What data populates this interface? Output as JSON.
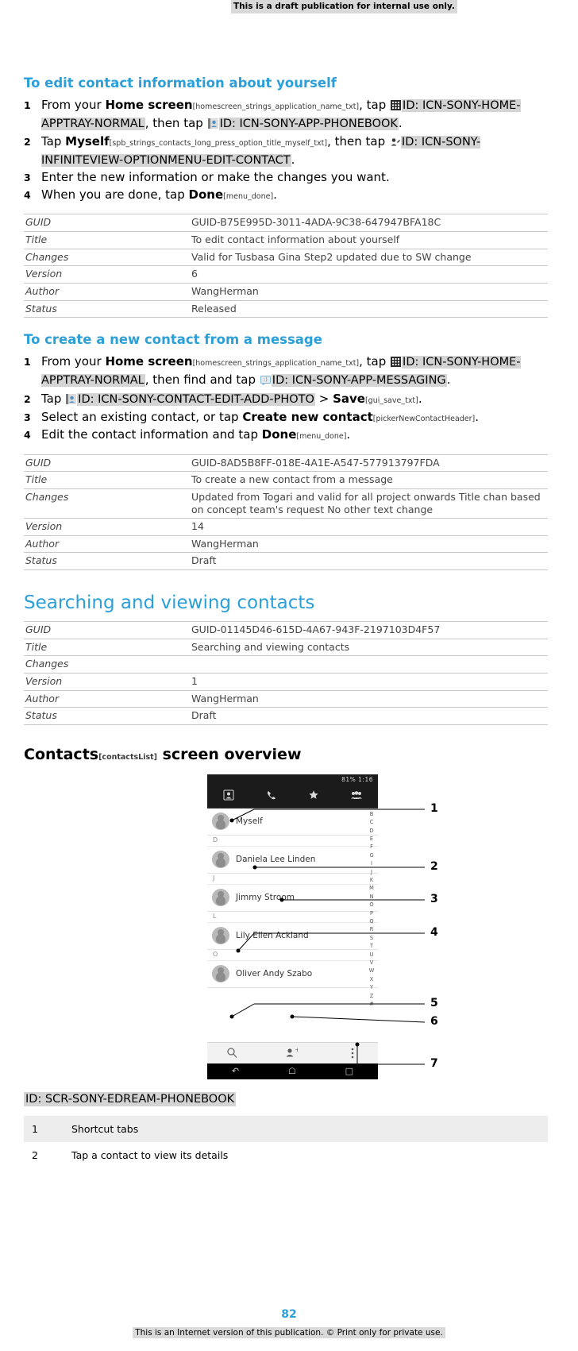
{
  "banner": "This is a draft publication for internal use only.",
  "sections": [
    {
      "title": "To edit contact information about yourself",
      "steps": [
        {
          "num": "1",
          "parts": [
            {
              "t": "text",
              "v": "From your "
            },
            {
              "t": "bold",
              "v": "Home screen"
            },
            {
              "t": "tag",
              "v": "[homescreen_strings_application_name_txt]"
            },
            {
              "t": "text",
              "v": ", tap "
            },
            {
              "t": "icon",
              "v": "apptray-grid-icon"
            },
            {
              "t": "id",
              "v": "ID: ICN-SONY-HOME-APPTRAY-NORMAL"
            },
            {
              "t": "text",
              "v": ", then tap "
            },
            {
              "t": "icon",
              "v": "phonebook-person-icon"
            },
            {
              "t": "id",
              "v": "ID: ICN-SONY-APP-PHONEBOOK"
            },
            {
              "t": "text",
              "v": "."
            }
          ]
        },
        {
          "num": "2",
          "parts": [
            {
              "t": "text",
              "v": "Tap "
            },
            {
              "t": "bold",
              "v": "Myself"
            },
            {
              "t": "tag",
              "v": "[spb_strings_contacts_long_press_option_title_myself_txt]"
            },
            {
              "t": "text",
              "v": ", then tap "
            },
            {
              "t": "icon",
              "v": "edit-contact-icon"
            },
            {
              "t": "id",
              "v": "ID: ICN-SONY-INFINITEVIEW-OPTIONMENU-EDIT-CONTACT"
            },
            {
              "t": "text",
              "v": "."
            }
          ]
        },
        {
          "num": "3",
          "parts": [
            {
              "t": "text",
              "v": "Enter the new information or make the changes you want."
            }
          ]
        },
        {
          "num": "4",
          "parts": [
            {
              "t": "text",
              "v": "When you are done, tap "
            },
            {
              "t": "bold",
              "v": "Done"
            },
            {
              "t": "tag",
              "v": "[menu_done]"
            },
            {
              "t": "text",
              "v": "."
            }
          ]
        }
      ],
      "meta": [
        {
          "key": "GUID",
          "value": "GUID-B75E995D-3011-4ADA-9C38-647947BFA18C"
        },
        {
          "key": "Title",
          "value": "To edit contact information about yourself"
        },
        {
          "key": "Changes",
          "value": "Valid for Tusbasa Gina Step2 updated due to SW change"
        },
        {
          "key": "Version",
          "value": "6"
        },
        {
          "key": "Author",
          "value": "WangHerman"
        },
        {
          "key": "Status",
          "value": "Released"
        }
      ]
    },
    {
      "title": "To create a new contact from a message",
      "steps": [
        {
          "num": "1",
          "parts": [
            {
              "t": "text",
              "v": "From your "
            },
            {
              "t": "bold",
              "v": "Home screen"
            },
            {
              "t": "tag",
              "v": "[homescreen_strings_application_name_txt]"
            },
            {
              "t": "text",
              "v": ", tap "
            },
            {
              "t": "icon",
              "v": "apptray-grid-icon"
            },
            {
              "t": "id",
              "v": "ID: ICN-SONY-HOME-APPTRAY-NORMAL"
            },
            {
              "t": "text",
              "v": ", then find and tap "
            },
            {
              "t": "icon",
              "v": "messaging-icon"
            },
            {
              "t": "id",
              "v": "ID: ICN-SONY-APP-MESSAGING"
            },
            {
              "t": "text",
              "v": "."
            }
          ]
        },
        {
          "num": "2",
          "parts": [
            {
              "t": "text",
              "v": "Tap "
            },
            {
              "t": "icon",
              "v": "add-photo-icon"
            },
            {
              "t": "id",
              "v": "ID: ICN-SONY-CONTACT-EDIT-ADD-PHOTO"
            },
            {
              "t": "text",
              "v": " > "
            },
            {
              "t": "bold",
              "v": "Save"
            },
            {
              "t": "tag",
              "v": "[gui_save_txt]"
            },
            {
              "t": "text",
              "v": "."
            }
          ]
        },
        {
          "num": "3",
          "parts": [
            {
              "t": "text",
              "v": "Select an existing contact, or tap "
            },
            {
              "t": "bold",
              "v": "Create new contact"
            },
            {
              "t": "tag",
              "v": "[pickerNewContactHeader]"
            },
            {
              "t": "text",
              "v": "."
            }
          ]
        },
        {
          "num": "4",
          "parts": [
            {
              "t": "text",
              "v": "Edit the contact information and tap "
            },
            {
              "t": "bold",
              "v": "Done"
            },
            {
              "t": "tag",
              "v": "[menu_done]"
            },
            {
              "t": "text",
              "v": "."
            }
          ]
        }
      ],
      "meta": [
        {
          "key": "GUID",
          "value": "GUID-8AD5B8FF-018E-4A1E-A547-577913797FDA"
        },
        {
          "key": "Title",
          "value": "To create a new contact from a message"
        },
        {
          "key": "Changes",
          "value": "Updated from Togari and valid for all project onwards Title chan based on concept team's request No other text change"
        },
        {
          "key": "Version",
          "value": "14"
        },
        {
          "key": "Author",
          "value": "WangHerman"
        },
        {
          "key": "Status",
          "value": "Draft"
        }
      ]
    }
  ],
  "chapter": {
    "title": "Searching and viewing contacts",
    "meta": [
      {
        "key": "GUID",
        "value": "GUID-01145D46-615D-4A67-943F-2197103D4F57"
      },
      {
        "key": "Title",
        "value": "Searching and viewing contacts"
      },
      {
        "key": "Changes",
        "value": ""
      },
      {
        "key": "Version",
        "value": "1"
      },
      {
        "key": "Author",
        "value": "WangHerman"
      },
      {
        "key": "Status",
        "value": "Draft"
      }
    ]
  },
  "overview": {
    "title_pre": "Contacts",
    "title_tag": "[contactsList]",
    "title_post": "screen overview",
    "screen_id": "ID: SCR-SONY-EDREAM-PHONEBOOK",
    "phone": {
      "status_right": "81%  1:16",
      "tabs": [
        "contacts-tab-icon",
        "calls-tab-icon",
        "favorites-tab-icon",
        "groups-tab-icon"
      ],
      "rows": [
        {
          "type": "contact",
          "name": "Myself"
        },
        {
          "type": "letter",
          "name": "D"
        },
        {
          "type": "contact",
          "name": "Daniela Lee Linden"
        },
        {
          "type": "letter",
          "name": "J"
        },
        {
          "type": "contact",
          "name": "Jimmy Stroom"
        },
        {
          "type": "letter",
          "name": "L"
        },
        {
          "type": "contact",
          "name": "Lily Ellen Ackland"
        },
        {
          "type": "letter",
          "name": "O"
        },
        {
          "type": "contact",
          "name": "Oliver Andy Szabo"
        }
      ],
      "alpha_index": [
        "B",
        "C",
        "D",
        "E",
        "F",
        "G",
        "I",
        "J",
        "K",
        "M",
        "N",
        "O",
        "P",
        "Q",
        "R",
        "S",
        "T",
        "U",
        "V",
        "W",
        "X",
        "Y",
        "Z",
        "#"
      ]
    },
    "callouts": [
      "1",
      "2",
      "3",
      "4",
      "5",
      "6",
      "7"
    ],
    "legend": [
      {
        "n": "1",
        "text": "Shortcut tabs"
      },
      {
        "n": "2",
        "text": "Tap a contact to view its details"
      }
    ]
  },
  "footer": {
    "page": "82",
    "note": "This is an Internet version of this publication. © Print only for private use."
  }
}
